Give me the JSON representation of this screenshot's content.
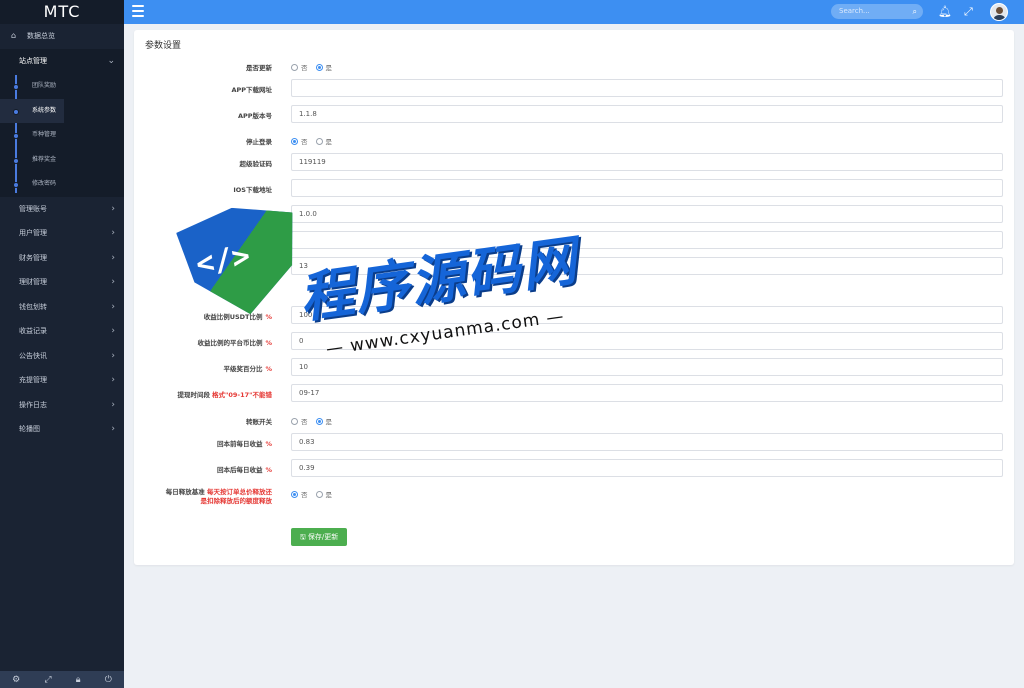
{
  "app": {
    "brand": "MTC"
  },
  "sidebar": {
    "home": "数据总览",
    "groups": [
      {
        "label": "站点管理"
      },
      {
        "label": "管理账号"
      },
      {
        "label": "用户管理"
      },
      {
        "label": "财务管理"
      },
      {
        "label": "理财管理"
      },
      {
        "label": "钱包划转"
      },
      {
        "label": "收益记录"
      },
      {
        "label": "公告快讯"
      },
      {
        "label": "充提管理"
      },
      {
        "label": "操作日志"
      },
      {
        "label": "轮播图"
      }
    ],
    "sub_items": [
      {
        "label": "团队奖励"
      },
      {
        "label": "系统参数"
      },
      {
        "label": "币种管理"
      },
      {
        "label": "推荐奖金"
      },
      {
        "label": "修改密码"
      }
    ],
    "footer_icons": [
      "gear-icon",
      "expand-icon",
      "lock-icon",
      "power-icon"
    ]
  },
  "topbar": {
    "search_placeholder": "Search...",
    "icons": [
      "menu-icon",
      "search-icon",
      "bell-icon",
      "fullscreen-icon",
      "avatar"
    ]
  },
  "form": {
    "title": "参数设置",
    "fields": {
      "update": {
        "label": "是否更新",
        "opt_no": "否",
        "opt_yes": "是",
        "selected": "是"
      },
      "app_url": {
        "label": "APP下载网址",
        "value": ""
      },
      "app_version": {
        "label": "APP版本号",
        "value": "1.1.8"
      },
      "stop_login": {
        "label": "停止登录",
        "opt_no": "否",
        "opt_yes": "是",
        "selected": "否"
      },
      "super_code": {
        "label": "超级验证码",
        "value": "119119"
      },
      "ios_url": {
        "label": "IOS下载地址",
        "value": ""
      },
      "version2": {
        "label": "版本",
        "value": "1.0.0"
      },
      "blank1": {
        "label": "",
        "value": ""
      },
      "val13": {
        "label": "",
        "value": "13"
      },
      "usdt_ratio": {
        "label": "收益比例USDT比例",
        "pct": "%",
        "value": "100"
      },
      "platform_ratio": {
        "label": "收益比例的平台币比例",
        "pct": "%",
        "value": "0"
      },
      "level_bonus": {
        "label": "平级奖百分比",
        "pct": "%",
        "value": "10"
      },
      "withdraw_time": {
        "label": "提现时间段",
        "hint": "格式\"09-17\"不能错",
        "value": "09-17"
      },
      "transfer_switch": {
        "label": "转账开关",
        "opt_no": "否",
        "opt_yes": "是",
        "selected": "是"
      },
      "before_return": {
        "label": "回本前每日收益",
        "pct": "%",
        "value": "0.83"
      },
      "after_return": {
        "label": "回本后每日收益",
        "pct": "%",
        "value": "0.39"
      },
      "release_base": {
        "label": "每日释放基准",
        "hint_line1": "每天按订单总价释放还",
        "hint_line2": "是扣除释放后的额度释放",
        "opt_no": "否",
        "opt_yes": "是",
        "selected": "否"
      }
    },
    "save_label": "保存/更新"
  },
  "watermark": {
    "title": "程序源码网",
    "url": "— www.cxyuanma.com —",
    "code": "</>"
  },
  "colors": {
    "sidebar": "#1a2333",
    "topbar": "#3d8ff2",
    "accent": "#4a7be0",
    "save": "#4cae4f",
    "danger": "#e53935"
  }
}
